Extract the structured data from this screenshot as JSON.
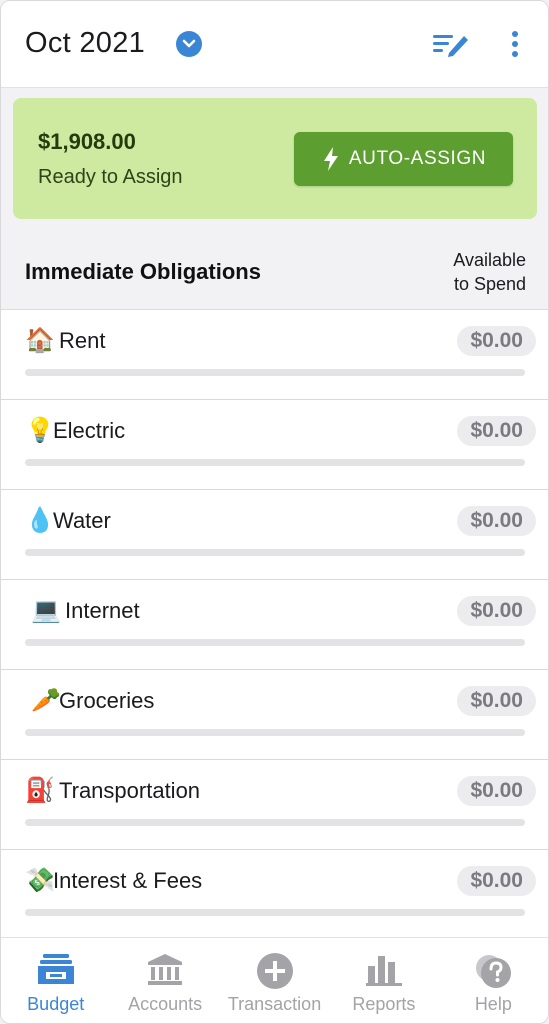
{
  "header": {
    "month": "Oct 2021",
    "month_toggle_icon": "chevron-down-circle-icon",
    "edit_icon": "edit-list-icon",
    "more_icon": "more-vertical-icon"
  },
  "assign": {
    "amount": "$1,908.00",
    "caption": "Ready to Assign",
    "button_label": "AUTO-ASSIGN",
    "button_icon": "lightning-bolt-icon"
  },
  "group": {
    "title": "Immediate Obligations",
    "col_line1": "Available",
    "col_line2": "to Spend"
  },
  "categories": [
    {
      "emoji": "🏠",
      "name": "Rent",
      "available": "$0.00"
    },
    {
      "emoji": "💡",
      "name": "Electric",
      "available": "$0.00"
    },
    {
      "emoji": "💧",
      "name": "Water",
      "available": "$0.00"
    },
    {
      "emoji": "💻",
      "name": "Internet",
      "available": "$0.00"
    },
    {
      "emoji": "🥕",
      "name": "Groceries",
      "available": "$0.00"
    },
    {
      "emoji": "⛽",
      "name": "Transportation",
      "available": "$0.00"
    },
    {
      "emoji": "💸",
      "name": "Interest & Fees",
      "available": "$0.00"
    }
  ],
  "nav": {
    "items": [
      {
        "label": "Budget",
        "icon": "budget-icon",
        "active": true
      },
      {
        "label": "Accounts",
        "icon": "bank-icon",
        "active": false
      },
      {
        "label": "Transaction",
        "icon": "plus-circle-icon",
        "active": false
      },
      {
        "label": "Reports",
        "icon": "bar-chart-icon",
        "active": false
      },
      {
        "label": "Help",
        "icon": "help-icon",
        "active": false
      }
    ]
  },
  "colors": {
    "accent": "#3a86d4",
    "banner": "#cdeaa0",
    "button": "#5c9e2f",
    "inactive": "#a3a3a8"
  }
}
